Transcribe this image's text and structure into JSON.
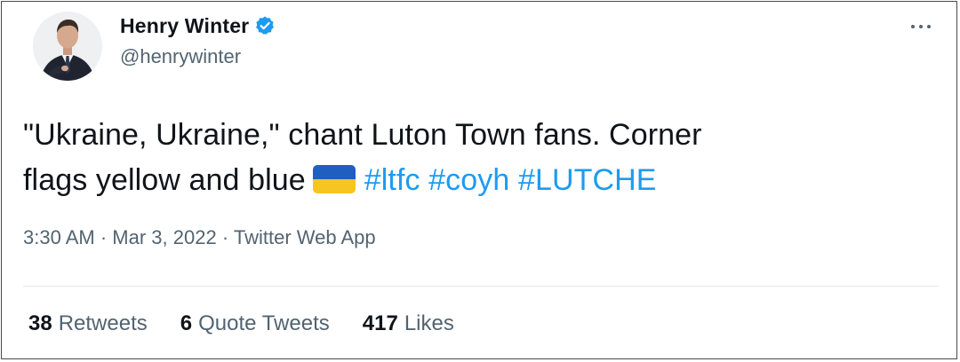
{
  "author": {
    "display_name": "Henry Winter",
    "handle": "@henrywinter",
    "verified": true,
    "avatar_icon": "profile-photo"
  },
  "more_icon": "more-horizontal-icon",
  "tweet": {
    "text_line1": "\"Ukraine, Ukraine,\" chant Luton Town fans. Corner",
    "text_line2_prefix": "flags yellow and blue",
    "emoji": "ukraine-flag-icon",
    "hashtags": [
      "#ltfc",
      "#coyh",
      "#LUTCHE"
    ]
  },
  "meta": {
    "time": "3:30 AM",
    "separator": "·",
    "date": "Mar 3, 2022",
    "source": "Twitter Web App"
  },
  "stats": [
    {
      "count": "38",
      "label": "Retweets"
    },
    {
      "count": "6",
      "label": "Quote Tweets"
    },
    {
      "count": "417",
      "label": "Likes"
    }
  ],
  "colors": {
    "link": "#1d9bf0",
    "secondary_text": "#536471",
    "primary_text": "#0f1419",
    "flag_blue": "#1f5fbf",
    "flag_yellow": "#f7c51f"
  }
}
